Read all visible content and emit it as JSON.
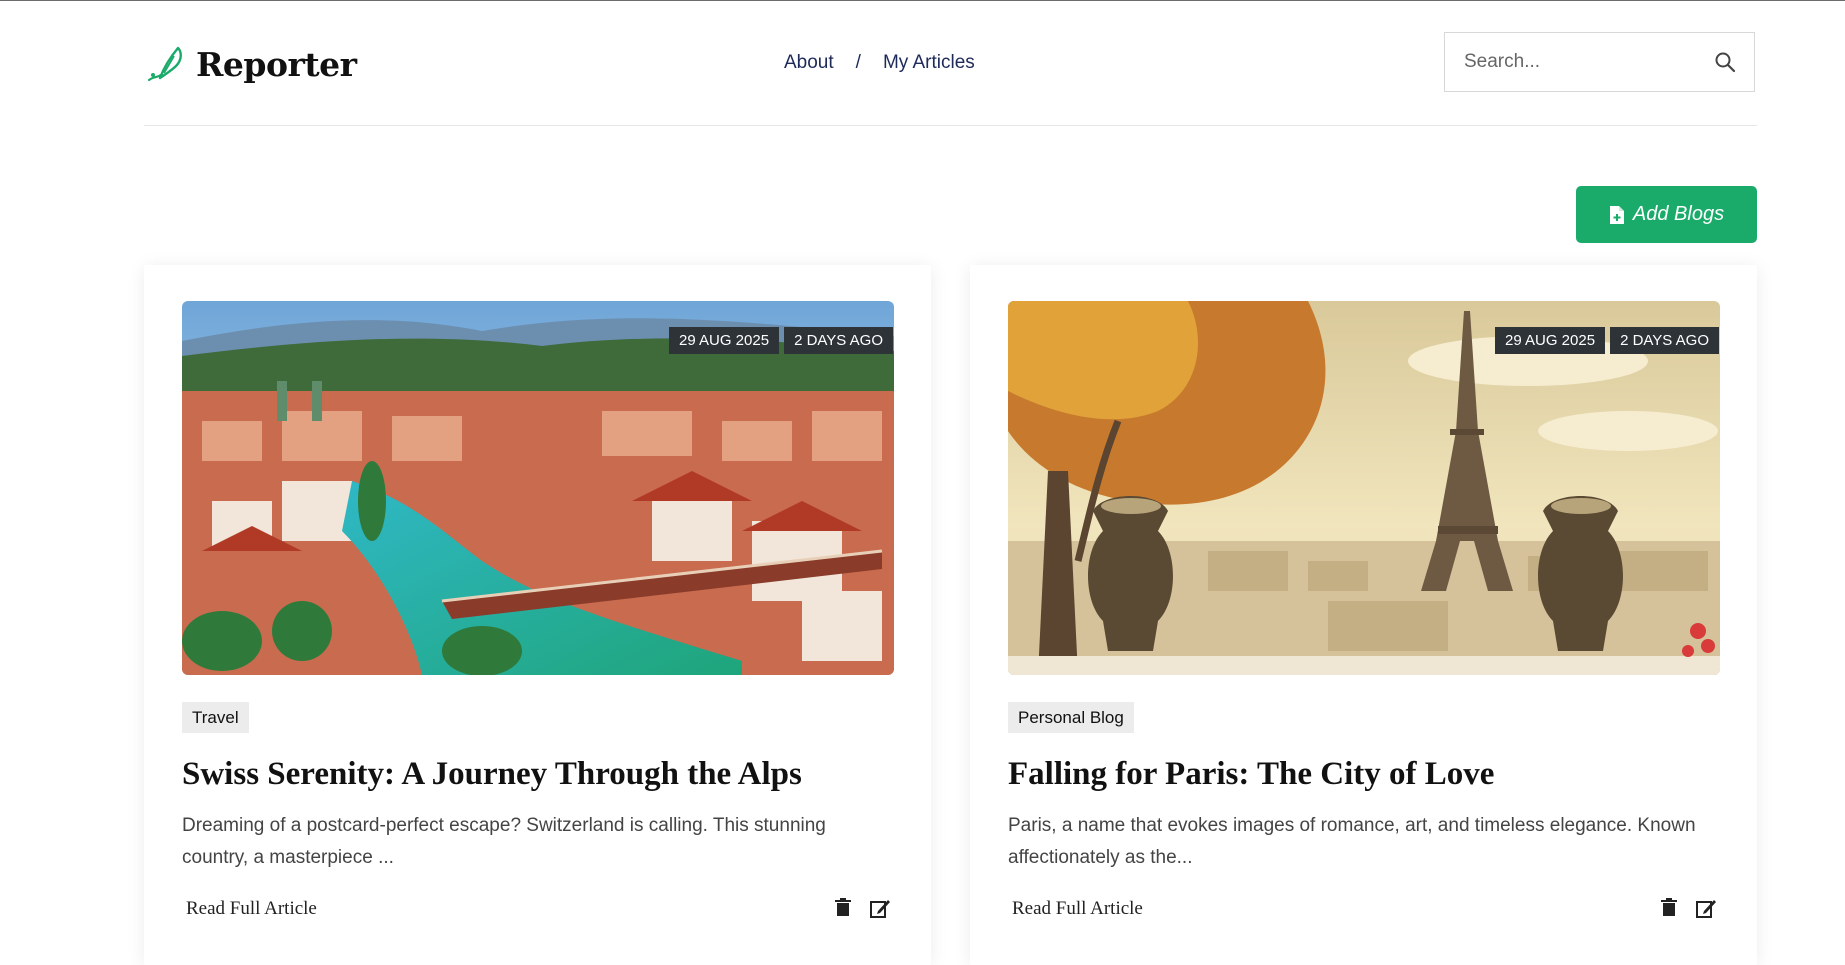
{
  "brand": {
    "name": "Reporter",
    "accent": "#1aab6a"
  },
  "nav": {
    "about": "About",
    "separator": "/",
    "my_articles": "My Articles"
  },
  "search": {
    "placeholder": "Search...",
    "icon": "search-icon"
  },
  "add_button": {
    "label": "Add Blogs",
    "icon": "file-plus-icon"
  },
  "articles": [
    {
      "date": "29 AUG 2025",
      "ago": "2 DAYS AGO",
      "category": "Travel",
      "title": "Swiss Serenity: A Journey Through the Alps",
      "excerpt": "Dreaming of a postcard-perfect escape? Switzerland is calling. This stunning country, a masterpiece ...",
      "read_more": "Read Full Article",
      "image": "lucerne-city-river-photo"
    },
    {
      "date": "29 AUG 2025",
      "ago": "2 DAYS AGO",
      "category": "Personal Blog",
      "title": "Falling for Paris: The City of Love",
      "excerpt": "Paris, a name that evokes images of romance, art, and timeless elegance. Known affectionately as the...",
      "read_more": "Read Full Article",
      "image": "paris-eiffel-tower-photo"
    }
  ]
}
